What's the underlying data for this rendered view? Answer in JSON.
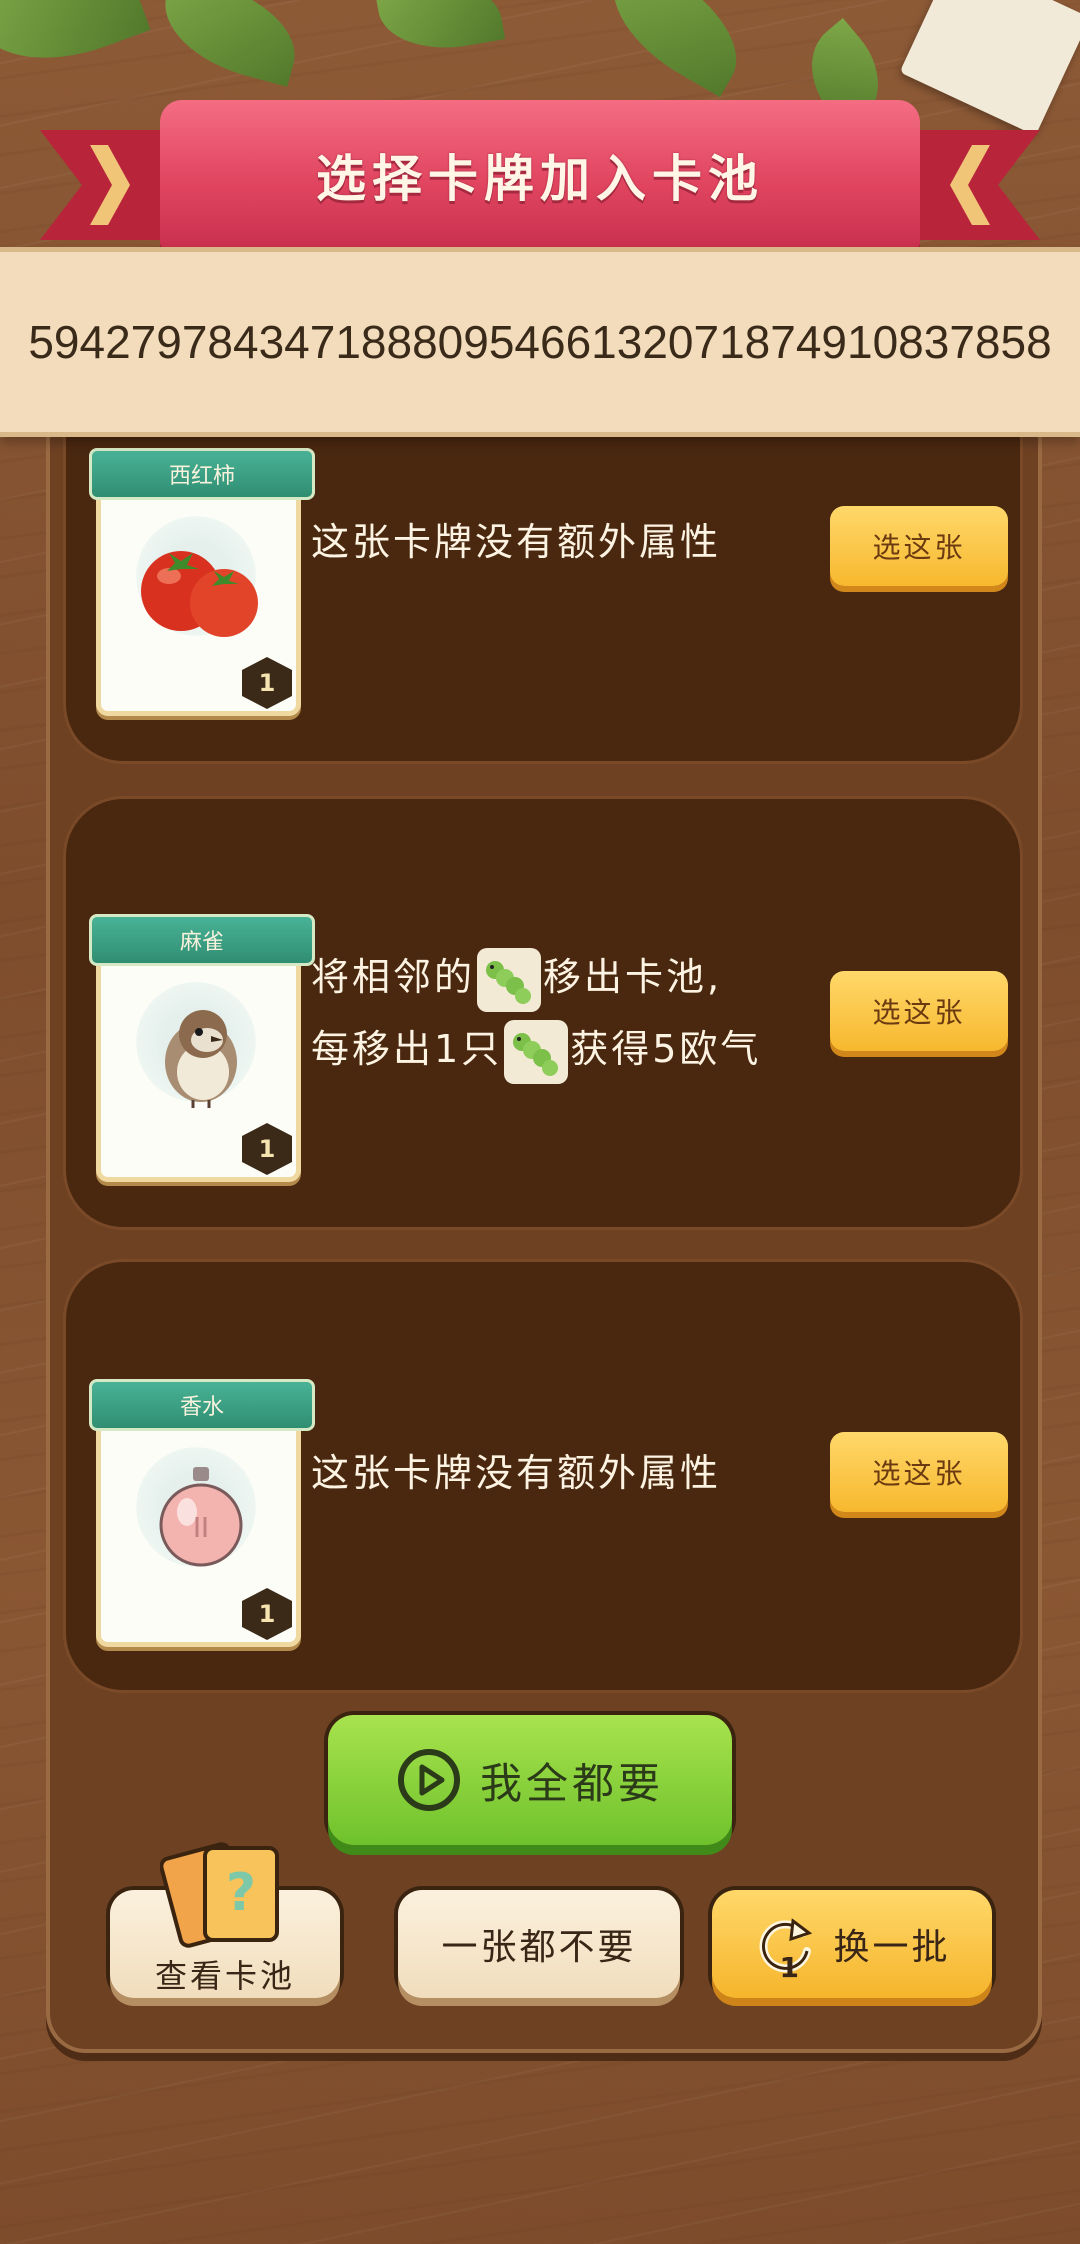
{
  "title": "选择卡牌加入卡池",
  "banner_number": "5942797843471888095466132071874910837858",
  "cards": [
    {
      "name": "西红柿",
      "level": "1",
      "description": "这张卡牌没有额外属性",
      "button": "选这张"
    },
    {
      "name": "麻雀",
      "level": "1",
      "description_line1_a": "将相邻的",
      "description_line1_b": "移出卡池,",
      "description_line2_a": "每移出1只",
      "description_line2_b": "获得5欧气",
      "button": "选这张",
      "inline_icon": "caterpillar-icon"
    },
    {
      "name": "香水",
      "level": "1",
      "description": "这张卡牌没有额外属性",
      "button": "选这张"
    }
  ],
  "buttons": {
    "take_all": "我全都要",
    "view_pool": "查看卡池",
    "take_none": "一张都不要",
    "refresh": "换一批",
    "refresh_count": "1"
  },
  "colors": {
    "accent_green": "#6fc22c",
    "accent_gold": "#f7b82e",
    "title_red": "#e14560"
  }
}
